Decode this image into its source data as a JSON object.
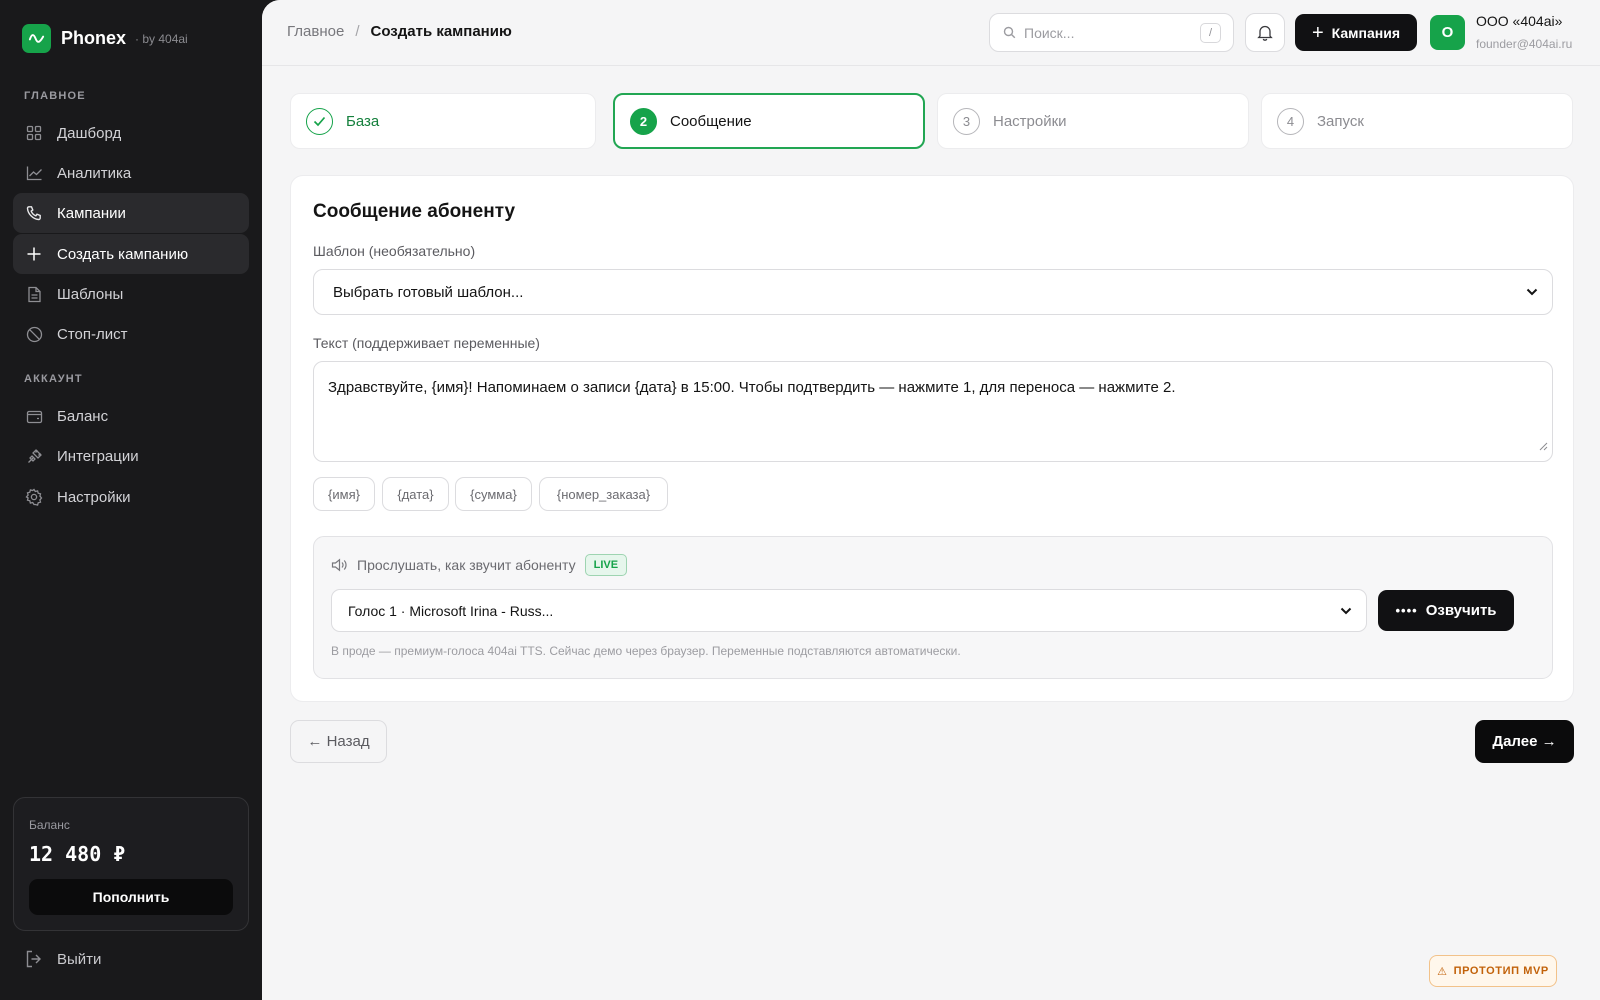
{
  "brand": {
    "name": "Phonex",
    "by": "· by 404ai"
  },
  "sidebar": {
    "section_main": "ГЛАВНОЕ",
    "section_account": "АККАУНТ",
    "items": [
      {
        "label": "Дашборд",
        "icon": "grid-icon"
      },
      {
        "label": "Аналитика",
        "icon": "chart-line-icon"
      },
      {
        "label": "Кампании",
        "icon": "phone-icon"
      },
      {
        "label": "Создать кампанию",
        "icon": "plus-icon"
      },
      {
        "label": "Шаблоны",
        "icon": "document-icon"
      },
      {
        "label": "Стоп-лист",
        "icon": "ban-icon"
      }
    ],
    "account_items": [
      {
        "label": "Баланс",
        "icon": "wallet-icon"
      },
      {
        "label": "Интеграции",
        "icon": "plug-icon"
      },
      {
        "label": "Настройки",
        "icon": "gear-icon"
      }
    ],
    "balance": {
      "label": "Баланс",
      "amount": "12 480 ₽",
      "button": "Пополнить"
    },
    "logout": "Выйти"
  },
  "header": {
    "breadcrumb": {
      "home": "Главное",
      "separator": "/",
      "current": "Создать кампанию"
    },
    "search": {
      "placeholder": "Поиск...",
      "shortcut": "/"
    },
    "new_campaign_label": "Кампания",
    "org": {
      "avatar": "О",
      "name": "ООО «404ai»",
      "email": "founder@404ai.ru"
    }
  },
  "steps": [
    {
      "number": "✓",
      "label": "База",
      "state": "done"
    },
    {
      "number": "2",
      "label": "Сообщение",
      "state": "active"
    },
    {
      "number": "3",
      "label": "Настройки",
      "state": "pending"
    },
    {
      "number": "4",
      "label": "Запуск",
      "state": "pending"
    }
  ],
  "form": {
    "title": "Сообщение абоненту",
    "template_label": "Шаблон (необязательно)",
    "template_value": "Выбрать готовый шаблон...",
    "text_label": "Текст (поддерживает переменные)",
    "text_value": "Здравствуйте, {имя}! Напоминаем о записи {дата} в 15:00. Чтобы подтвердить — нажмите 1, для переноса — нажмите 2.",
    "variables": [
      "{имя}",
      "{дата}",
      "{сумма}",
      "{номер_заказа}"
    ],
    "preview": {
      "title": "Прослушать, как звучит абоненту",
      "live_badge": "LIVE",
      "voice_value": "Голос 1 · Microsoft Irina - Russ...",
      "speak_button": "Озвучить",
      "note": "В проде — премиум-голоса 404ai TTS. Сейчас демо через браузер. Переменные подставляются автоматически."
    }
  },
  "nav_buttons": {
    "back": "← Назад",
    "next": "Далее →"
  },
  "badge": "ПРОТОТИП MVP",
  "colors": {
    "accent": "#16a34a",
    "sidebar_bg": "#19191b",
    "primary_button": "#111113"
  }
}
